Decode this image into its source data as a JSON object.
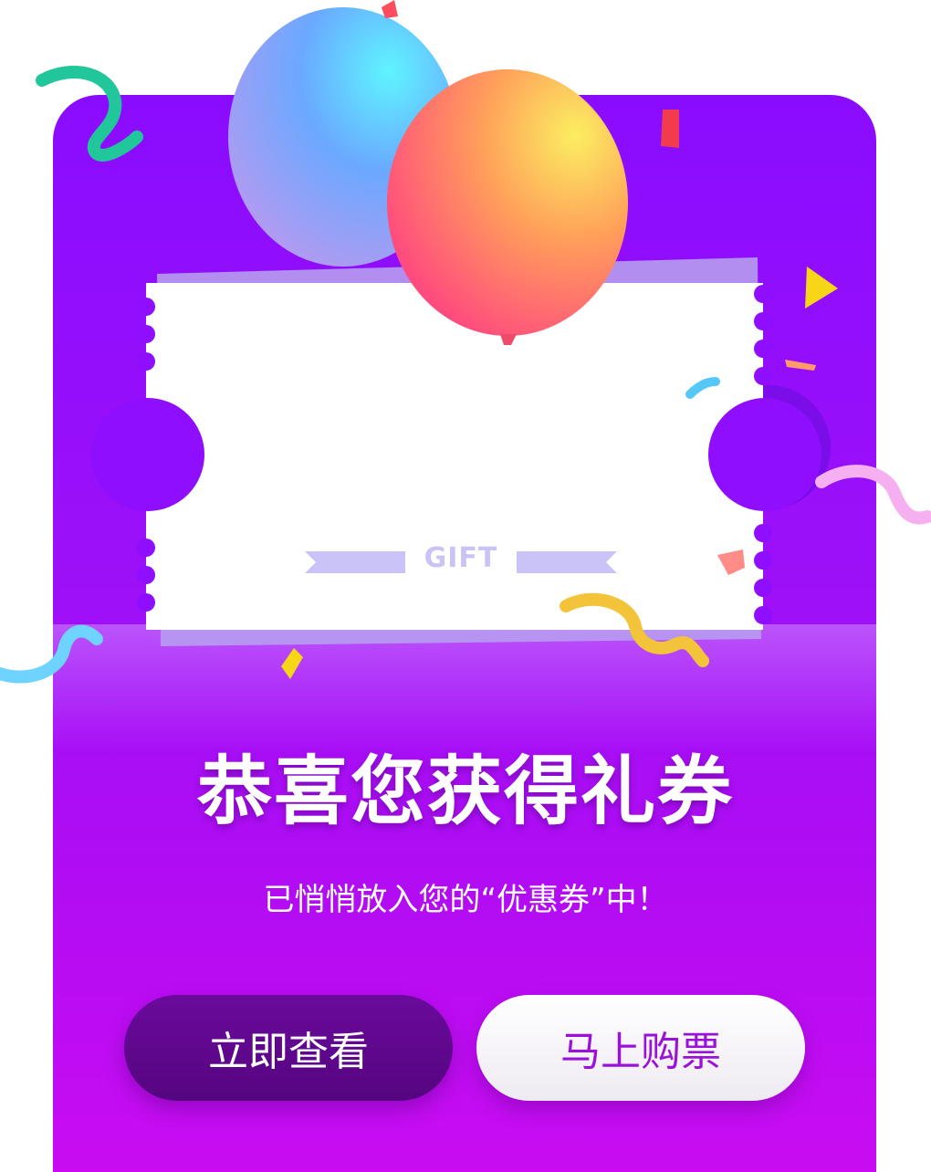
{
  "popup": {
    "ticket_label": "GIFT",
    "title": "恭喜您获得礼券",
    "subtitle": "已悄悄放入您的“优惠券”中！",
    "view_button_label": "立即查看",
    "buy_button_label": "马上购票"
  },
  "colors": {
    "card_top": "#8a0cff",
    "card_bottom": "#c90cf2",
    "view_button": "#5f0890",
    "buy_button_text": "#9a12d8",
    "ticket": "#ffffff",
    "gift_label": "#c9c3f7"
  },
  "decorations": [
    "blue-balloon",
    "orange-balloon",
    "confetti-ribbons"
  ]
}
